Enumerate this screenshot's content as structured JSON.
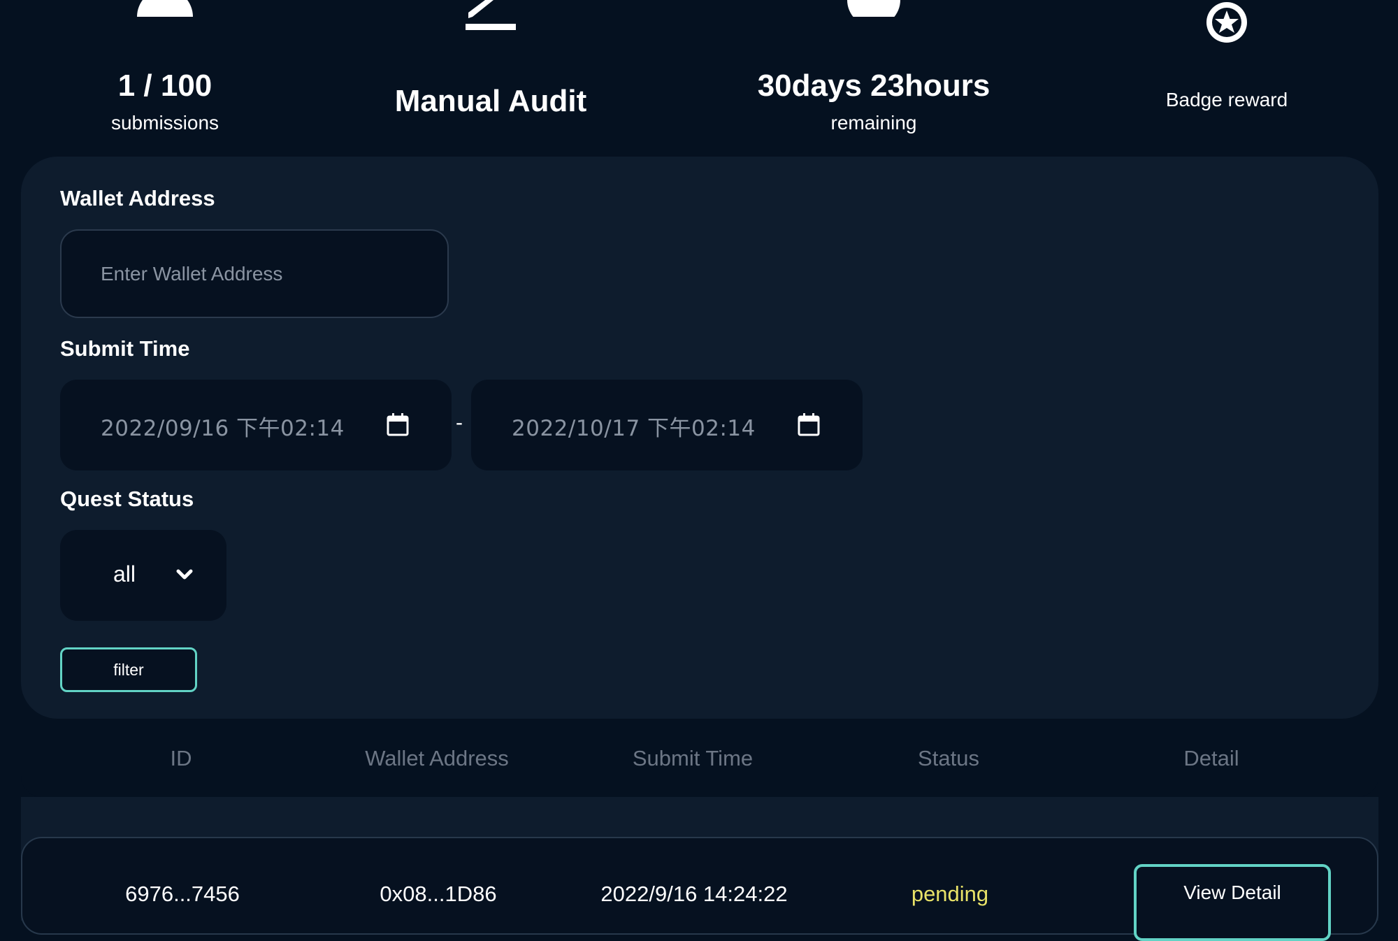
{
  "stats": {
    "submissions": {
      "value": "1 / 100",
      "caption": "submissions",
      "icon": "user-icon"
    },
    "audit": {
      "value": "Manual Audit",
      "icon": "edit-icon"
    },
    "remaining": {
      "value": "30days 23hours",
      "caption": "remaining",
      "icon": "clock-icon"
    },
    "reward": {
      "caption": "Badge reward",
      "icon": "star-badge-icon"
    }
  },
  "filters": {
    "wallet_label": "Wallet Address",
    "wallet_placeholder": "Enter Wallet Address",
    "submit_time_label": "Submit Time",
    "start_date": "2022/09/16 下午02:14",
    "end_date": "2022/10/17 下午02:14",
    "date_separator": "-",
    "calendar_icon": "calendar-icon",
    "status_label": "Quest Status",
    "status_value": "all",
    "status_icon": "chevron-down-icon",
    "filter_button": "filter"
  },
  "table": {
    "columns": [
      "ID",
      "Wallet Address",
      "Submit Time",
      "Status",
      "Detail"
    ],
    "rows": [
      {
        "id": "6976...7456",
        "wallet": "0x08...1D86",
        "submit_time": "2022/9/16 14:24:22",
        "status": "pending",
        "detail_button": "View Detail"
      }
    ]
  },
  "colors": {
    "background": "#051120",
    "panel": "#0e1c2d",
    "accent": "#62d3c5",
    "pending": "#e8e268",
    "muted_text": "#6c7685"
  }
}
